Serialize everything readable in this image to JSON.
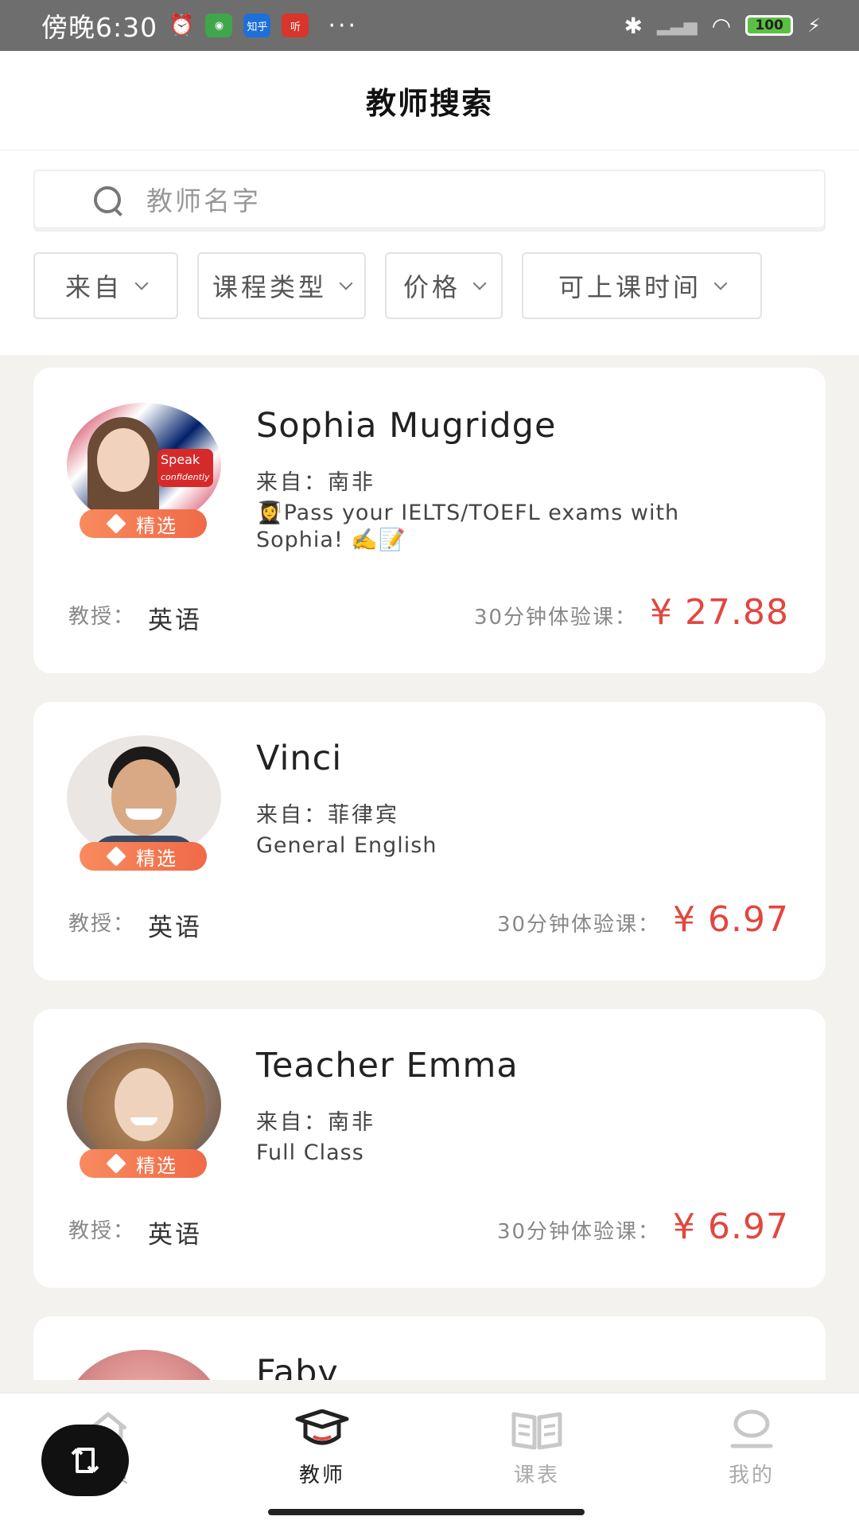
{
  "status_bar": {
    "time": "傍晚6:30",
    "app_chips": [
      "知乎",
      "听"
    ],
    "more": "···",
    "battery": "100"
  },
  "header": {
    "title": "教师搜索"
  },
  "search": {
    "placeholder": "教师名字",
    "value": ""
  },
  "filters": [
    {
      "label": "来自"
    },
    {
      "label": "课程类型"
    },
    {
      "label": "价格"
    },
    {
      "label": "可上课时间"
    }
  ],
  "teachers": [
    {
      "name": "Sophia Mugridge",
      "from_label": "来自：",
      "country": "南非",
      "desc_line1": "👩‍🎓Pass your IELTS/TOEFL exams with",
      "desc_line2": "Sophia! ✍️📝",
      "badge": "精选",
      "avatar_text_1": "Speak",
      "avatar_text_2": "confidently",
      "teach_label": "教授：",
      "subject": "英语",
      "price_label": "30分钟体验课：",
      "price": "¥ 27.88"
    },
    {
      "name": "Vinci",
      "from_label": "来自：",
      "country": "菲律宾",
      "desc_line1": "General English",
      "badge": "精选",
      "teach_label": "教授：",
      "subject": "英语",
      "price_label": "30分钟体验课：",
      "price": "¥ 6.97"
    },
    {
      "name": "Teacher Emma",
      "from_label": "来自：",
      "country": "南非",
      "desc_line1": "Full Class",
      "badge": "精选",
      "teach_label": "教授：",
      "subject": "英语",
      "price_label": "30分钟体验课：",
      "price": "¥ 6.97"
    },
    {
      "name": "Faby"
    }
  ],
  "bottom_nav": [
    {
      "label": "首页",
      "icon": "home-icon",
      "active": false
    },
    {
      "label": "教师",
      "icon": "graduation-cap-icon",
      "active": true
    },
    {
      "label": "课表",
      "icon": "book-icon",
      "active": false
    },
    {
      "label": "我的",
      "icon": "profile-icon",
      "active": false
    }
  ],
  "colors": {
    "price": "#e2463f",
    "badge": "#f27a52",
    "battery": "#5bbf45"
  }
}
